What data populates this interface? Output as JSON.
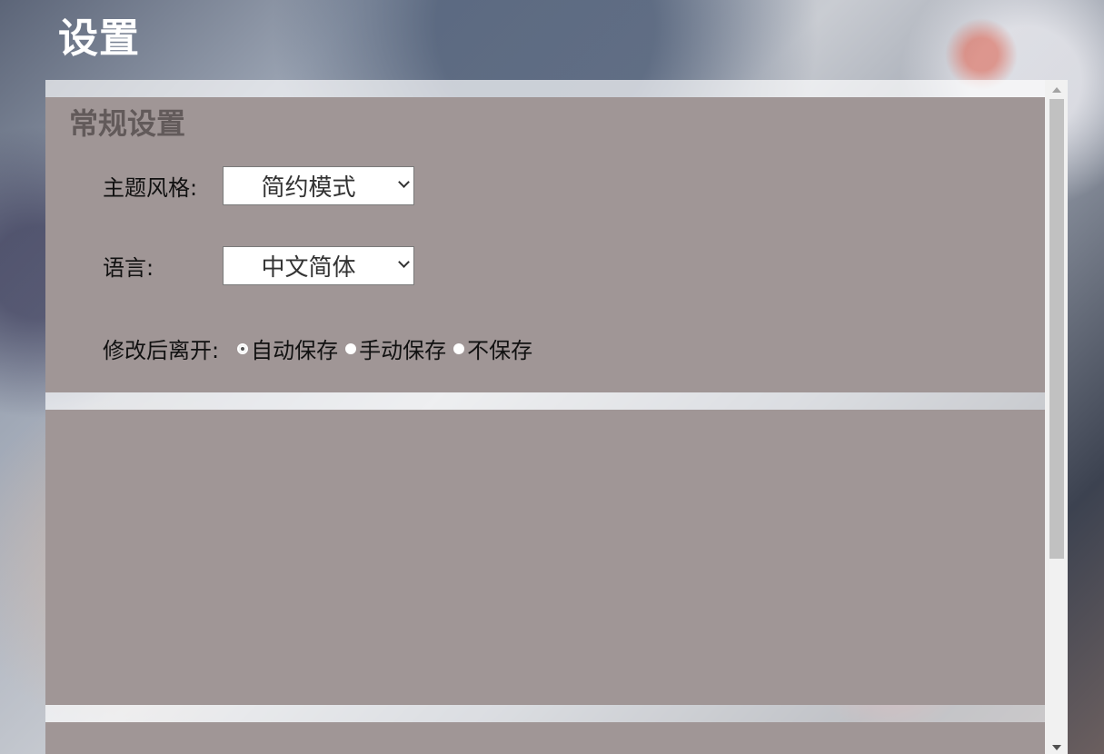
{
  "page": {
    "title": "设置"
  },
  "general": {
    "title": "常规设置",
    "theme": {
      "label": "主题风格:",
      "value": "简约模式"
    },
    "language": {
      "label": "语言:",
      "value": "中文简体"
    },
    "leave": {
      "label": "修改后离开:",
      "options": [
        "自动保存",
        "手动保存",
        "不保存"
      ],
      "selected": "自动保存"
    }
  },
  "colors": {
    "section_bg": "#a09696",
    "section_title": "#625a5a",
    "title_text": "#ffffff"
  }
}
